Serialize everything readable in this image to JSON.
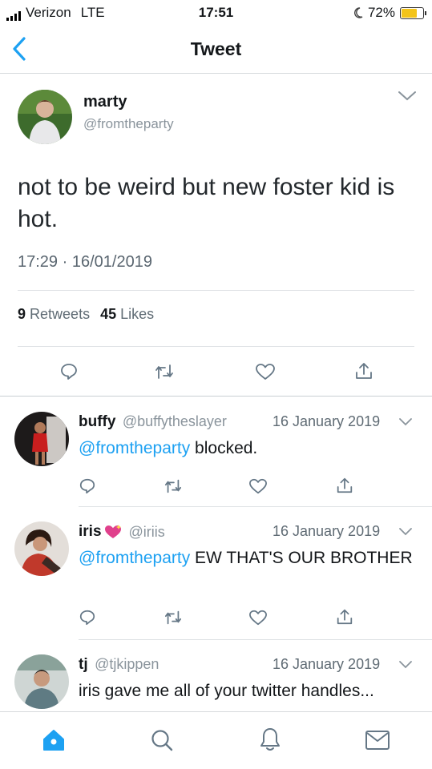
{
  "status": {
    "carrier": "Verizon",
    "network": "LTE",
    "time": "17:51",
    "battery": "72%",
    "battery_level": 0.72
  },
  "nav": {
    "title": "Tweet"
  },
  "tweet": {
    "name": "marty",
    "handle": "@fromtheparty",
    "text": "not to be weird but new foster kid is hot.",
    "time": "17:29",
    "date": "16/01/2019",
    "retweets": "9",
    "retweets_label": "Retweets",
    "likes": "45",
    "likes_label": "Likes"
  },
  "replies": [
    {
      "name": "buffy",
      "handle": "@buffytheslayer",
      "date": "16 January 2019",
      "mention": "@fromtheparty",
      "text": "blocked."
    },
    {
      "name": "iris",
      "handle": "@iriis",
      "date": "16 January 2019",
      "mention": "@fromtheparty",
      "text": "EW THAT'S OUR BROTHER"
    },
    {
      "name": "tj",
      "handle": "@tjkippen",
      "date": "16 January 2019",
      "mention": "",
      "text": "iris gave me all of your twitter handles..."
    }
  ],
  "colors": {
    "accent": "#1da1f2",
    "icon": "#657786"
  }
}
